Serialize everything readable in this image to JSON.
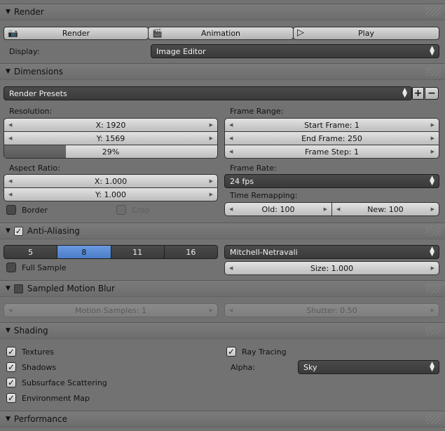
{
  "render": {
    "title": "Render",
    "render_btn": "Render",
    "animation_btn": "Animation",
    "play_btn": "Play",
    "display_label": "Display:",
    "display_value": "Image Editor"
  },
  "dimensions": {
    "title": "Dimensions",
    "presets": "Render Presets",
    "resolution_label": "Resolution:",
    "res_x": "X: 1920",
    "res_y": "Y: 1569",
    "res_pct": "29%",
    "res_pct_value": 0.29,
    "frame_range_label": "Frame Range:",
    "start_frame": "Start Frame: 1",
    "end_frame": "End Frame: 250",
    "frame_step": "Frame Step: 1",
    "aspect_label": "Aspect Ratio:",
    "aspect_x": "X: 1.000",
    "aspect_y": "Y: 1.000",
    "frame_rate_label": "Frame Rate:",
    "frame_rate": "24 fps",
    "time_remap_label": "Time Remapping:",
    "old": "Old: 100",
    "new": "New: 100",
    "border": "Border",
    "crop": "Crop"
  },
  "aa": {
    "title": "Anti-Aliasing",
    "samples": [
      "5",
      "8",
      "11",
      "16"
    ],
    "selected": "8",
    "filter": "Mitchell-Netravali",
    "full_sample": "Full Sample",
    "size": "Size: 1.000"
  },
  "mblur": {
    "title": "Sampled Motion Blur",
    "motion_samples": "Motion Samples: 1",
    "shutter": "Shutter: 0.50"
  },
  "shading": {
    "title": "Shading",
    "textures": "Textures",
    "shadows": "Shadows",
    "sss": "Subsurface Scattering",
    "env_map": "Environment Map",
    "ray_tracing": "Ray Tracing",
    "alpha_label": "Alpha:",
    "alpha_value": "Sky"
  },
  "performance": {
    "title": "Performance"
  },
  "colors": {
    "selected": "#5a8ad6",
    "background": "#727272"
  }
}
